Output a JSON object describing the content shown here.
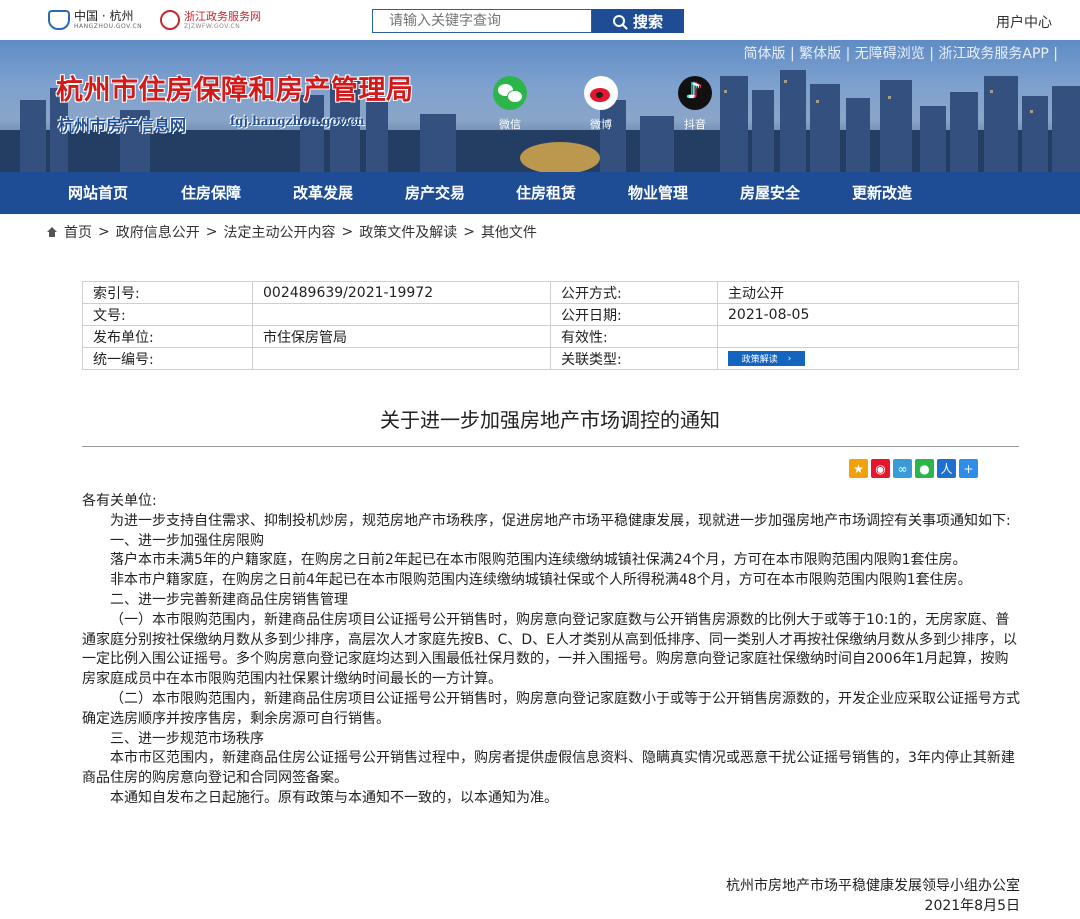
{
  "header": {
    "gov_logo_name": "中国 · 杭州",
    "gov_logo_domain": "HANGZHOU.GOV.CN",
    "zj_logo_name": "浙江政务服务网",
    "zj_logo_domain": "ZJZWFW.GOV.CN",
    "search_placeholder": "请输入关键字查询",
    "search_button": "搜索",
    "user_center": "用户中心"
  },
  "banner": {
    "links": "简体版 | 繁体版 | 无障碍浏览 | 浙江政务服务APP |",
    "title": "杭州市住房保障和房产管理局",
    "subtitle": "杭州市房产信息网",
    "url": "fgj.hangzhou.gov.cn",
    "social": [
      {
        "label": "微信",
        "icon": "wechat-icon"
      },
      {
        "label": "微博",
        "icon": "weibo-icon"
      },
      {
        "label": "抖音",
        "icon": "douyin-icon"
      }
    ]
  },
  "nav": {
    "items": [
      "网站首页",
      "住房保障",
      "改革发展",
      "房产交易",
      "住房租赁",
      "物业管理",
      "房屋安全",
      "更新改造"
    ]
  },
  "breadcrumb": {
    "items": [
      "首页",
      "政府信息公开",
      "法定主动公开内容",
      "政策文件及解读",
      "其他文件"
    ],
    "sep": ">"
  },
  "meta": {
    "rows": [
      {
        "k1": "索引号:",
        "v1": "002489639/2021-19972",
        "k2": "公开方式:",
        "v2": "主动公开"
      },
      {
        "k1": "文号:",
        "v1": "",
        "k2": "公开日期:",
        "v2": "2021-08-05"
      },
      {
        "k1": "发布单位:",
        "v1": "市住保房管局",
        "k2": "有效性:",
        "v2": ""
      },
      {
        "k1": "统一编号:",
        "v1": "",
        "k2": "关联类型:",
        "v2": ""
      }
    ],
    "related_button": "政策解读",
    "related_arrow": "›"
  },
  "article": {
    "title": "关于进一步加强房地产市场调控的通知",
    "salutation": "各有关单位:",
    "paragraphs": [
      "为进一步支持自住需求、抑制投机炒房，规范房地产市场秩序，促进房地产市场平稳健康发展，现就进一步加强房地产市场调控有关事项通知如下:",
      "一、进一步加强住房限购",
      "落户本市未满5年的户籍家庭，在购房之日前2年起已在本市限购范围内连续缴纳城镇社保满24个月，方可在本市限购范围内限购1套住房。",
      "非本市户籍家庭，在购房之日前4年起已在本市限购范围内连续缴纳城镇社保或个人所得税满48个月，方可在本市限购范围内限购1套住房。",
      "二、进一步完善新建商品住房销售管理",
      "（一）本市限购范围内，新建商品住房项目公证摇号公开销售时，购房意向登记家庭数与公开销售房源数的比例大于或等于10:1的，无房家庭、普通家庭分别按社保缴纳月数从多到少排序，高层次人才家庭先按B、C、D、E人才类别从高到低排序、同一类别人才再按社保缴纳月数从多到少排序，以一定比例入围公证摇号。多个购房意向登记家庭均达到入围最低社保月数的，一并入围摇号。购房意向登记家庭社保缴纳时间自2006年1月起算，按购房家庭成员中在本市限购范围内社保累计缴纳时间最长的一方计算。",
      "（二）本市限购范围内，新建商品住房项目公证摇号公开销售时，购房意向登记家庭数小于或等于公开销售房源数的，开发企业应采取公证摇号方式确定选房顺序并按序售房，剩余房源可自行销售。",
      "三、进一步规范市场秩序",
      "本市市区范围内，新建商品住房公证摇号公开销售过程中，购房者提供虚假信息资料、隐瞒真实情况或恶意干扰公证摇号销售的，3年内停止其新建商品住房的购房意向登记和合同网签备案。",
      "本通知自发布之日起施行。原有政策与本通知不一致的，以本通知为准。"
    ],
    "signature_org": "杭州市房地产市场平稳健康发展领导小组办公室",
    "signature_date": "2021年8月5日"
  },
  "share_icons": [
    "qzone-icon",
    "weibo-share-icon",
    "tencent-share-icon",
    "wechat-share-icon",
    "renren-share-icon",
    "more-share-icon"
  ],
  "colors": {
    "primary": "#1e4d95",
    "title_red": "#d31a1a"
  }
}
